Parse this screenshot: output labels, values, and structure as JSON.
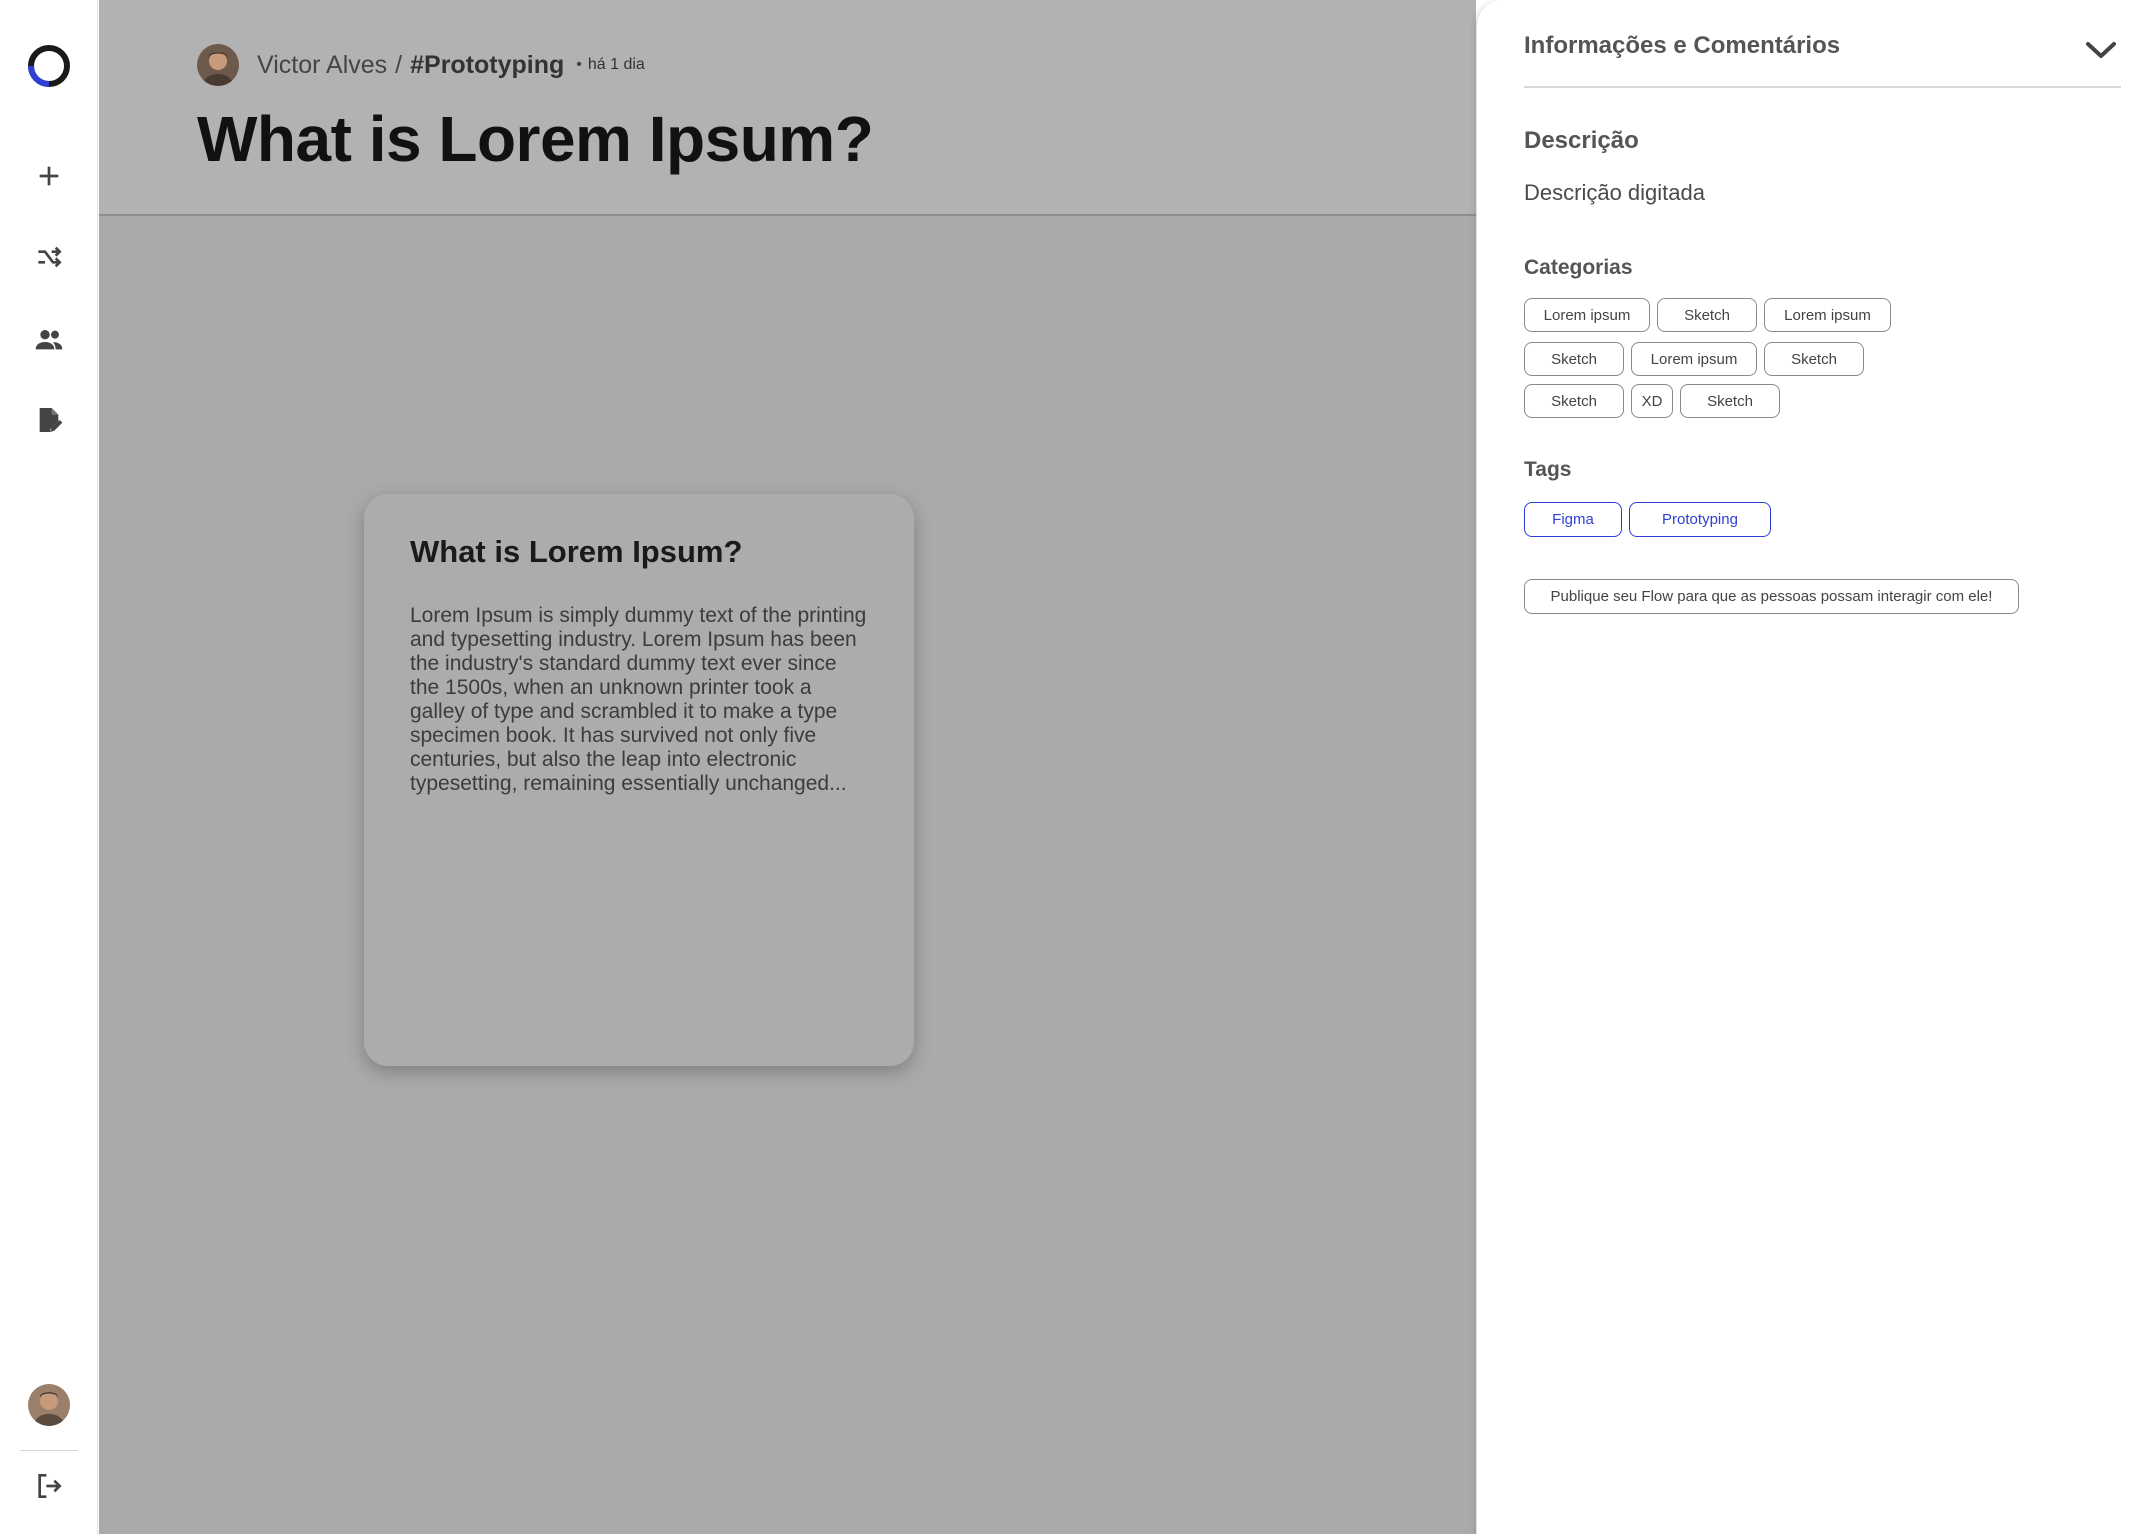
{
  "sidebar": {
    "logo": "flow-logo",
    "items": [
      {
        "name": "add-icon"
      },
      {
        "name": "shuffle-icon"
      },
      {
        "name": "people-icon"
      },
      {
        "name": "edit-document-icon"
      }
    ],
    "logout": "logout-icon"
  },
  "post": {
    "author": "Victor Alves",
    "separator": "/",
    "community": "#Prototyping",
    "dot": "•",
    "time": "há 1 dia",
    "title": "What is Lorem Ipsum?"
  },
  "card": {
    "title": "What is Lorem Ipsum?",
    "text": "Lorem Ipsum is simply dummy text of the printing and typesetting industry. Lorem Ipsum has been the industry's standard dummy text ever since the 1500s, when an unknown printer took a galley of type and scrambled it to make a type specimen book. It has survived not only five centuries, but also the leap into electronic typesetting, remaining essentially unchanged..."
  },
  "panel": {
    "title": "Informações e Comentários",
    "description_title": "Descrição",
    "description_text": "Descrição digitada",
    "categories_title": "Categorias",
    "categories": [
      [
        "Lorem ipsum",
        "Sketch",
        "Lorem ipsum"
      ],
      [
        "Sketch",
        "Lorem ipsum",
        "Sketch"
      ],
      [
        "Sketch",
        "XD",
        "Sketch"
      ]
    ],
    "tags_title": "Tags",
    "tags": [
      "Figma",
      "Prototyping"
    ],
    "publish_label": "Publique seu Flow para que as pessoas possam interagir com ele!"
  },
  "colors": {
    "accent": "#2f3fd6",
    "overlay": "#a9aaab"
  }
}
